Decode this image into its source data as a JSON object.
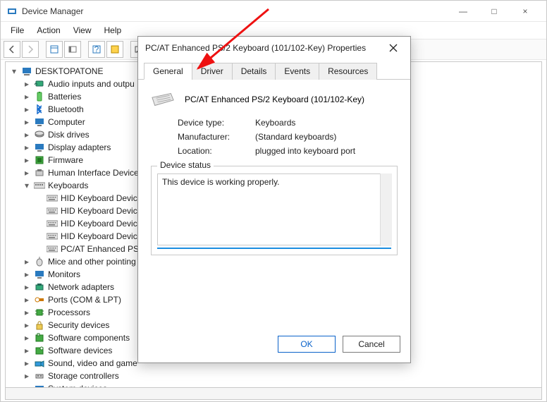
{
  "window": {
    "title": "Device Manager",
    "controls": {
      "minimize": "—",
      "maximize": "□",
      "close": "×"
    },
    "menu": [
      "File",
      "Action",
      "View",
      "Help"
    ]
  },
  "tree": {
    "root": "DESKTOPATONE",
    "nodes": [
      "Audio inputs and outpu",
      "Batteries",
      "Bluetooth",
      "Computer",
      "Disk drives",
      "Display adapters",
      "Firmware",
      "Human Interface Device"
    ],
    "keyboards_label": "Keyboards",
    "keyboards": [
      "HID Keyboard Device",
      "HID Keyboard Device",
      "HID Keyboard Device",
      "HID Keyboard Device",
      "PC/AT Enhanced PS/"
    ],
    "nodes_after": [
      "Mice and other pointing",
      "Monitors",
      "Network adapters",
      "Ports (COM & LPT)",
      "Processors",
      "Security devices",
      "Software components",
      "Software devices",
      "Sound, video and game",
      "Storage controllers",
      "System devices"
    ]
  },
  "dialog": {
    "title": "PC/AT Enhanced PS/2 Keyboard (101/102-Key) Properties",
    "tabs": [
      "General",
      "Driver",
      "Details",
      "Events",
      "Resources"
    ],
    "active_tab": 0,
    "device_name": "PC/AT Enhanced PS/2 Keyboard (101/102-Key)",
    "rows": {
      "type_label": "Device type:",
      "type_value": "Keyboards",
      "mfr_label": "Manufacturer:",
      "mfr_value": "(Standard keyboards)",
      "loc_label": "Location:",
      "loc_value": "plugged into keyboard port"
    },
    "status_group_label": "Device status",
    "status_text": "This device is working properly.",
    "ok_label": "OK",
    "cancel_label": "Cancel"
  }
}
